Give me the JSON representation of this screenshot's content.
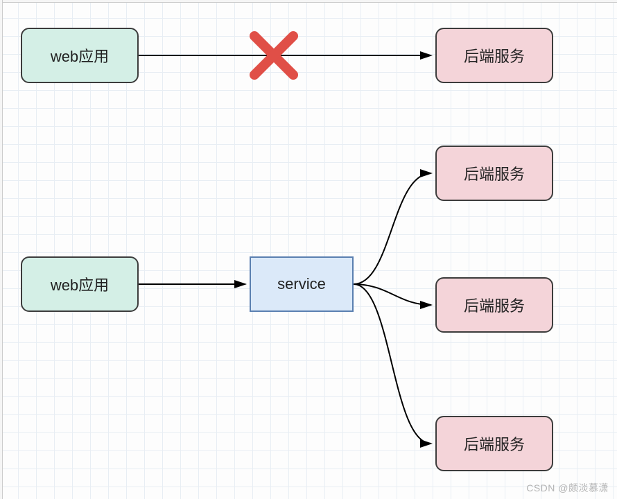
{
  "diagram": {
    "top": {
      "web_app": "web应用",
      "backend": "后端服务",
      "blocked": true
    },
    "bottom": {
      "web_app": "web应用",
      "service": "service",
      "backends": [
        "后端服务",
        "后端服务",
        "后端服务"
      ]
    }
  },
  "icons": {
    "cross": "✕"
  },
  "watermark": "CSDN @颇淡慕潇",
  "colors": {
    "teal_fill": "#d4efe6",
    "pink_fill": "#f4d4d9",
    "blue_fill": "#dbe9f9",
    "cross": "#e04f47",
    "grid": "#e8eef4"
  }
}
